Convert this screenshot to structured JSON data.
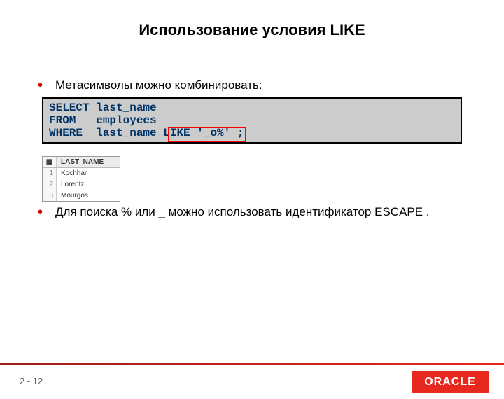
{
  "title": "Использование условия LIKE",
  "bullets": {
    "b1": "Метасимволы можно комбинировать:",
    "b2": "Для поиска % или _ можно использовать идентификатор ESCAPE ."
  },
  "sql": {
    "line1": "SELECT last_name",
    "line2": "FROM   employees",
    "line3a": "WHERE  last_name ",
    "line3b": "LIKE '_o%'",
    "line3c": " ;"
  },
  "result": {
    "header": "LAST_NAME",
    "rows": [
      {
        "n": "1",
        "v": "Kochhar"
      },
      {
        "n": "2",
        "v": "Lorentz"
      },
      {
        "n": "3",
        "v": "Mourgos"
      }
    ]
  },
  "footer": {
    "prefix": "2 - ",
    "page": "12",
    "logo": "ORACLE"
  }
}
